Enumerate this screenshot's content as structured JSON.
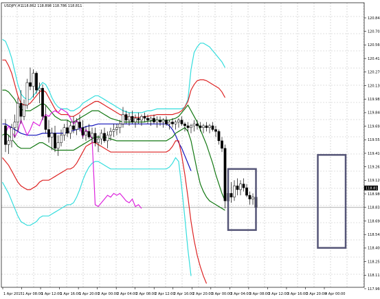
{
  "header": {
    "symbol": "USDJPY,H1",
    "ohlc": "118.862 118.898 118.786 118.811"
  },
  "price_tag": "118.811",
  "colors": {
    "background": "#ffffff",
    "grid": "#c0c0c0",
    "axis": "#000000",
    "candle_up_body": "#ffffff",
    "candle_down_body": "#000000",
    "bb_outer": "#33dddd",
    "bb_mid": "#dd2222",
    "bb_inner": "#117711",
    "ma": "#1111bb",
    "chikou": "#dd22dd",
    "box": "#555577"
  },
  "chart_data": {
    "type": "line",
    "y_ticks": [
      "120.845",
      "120.705",
      "120.560",
      "120.415",
      "120.270",
      "120.130",
      "119.985",
      "119.840",
      "119.695",
      "119.555",
      "119.410",
      "119.265",
      "119.120",
      "118.980",
      "118.835",
      "118.690",
      "118.545",
      "118.400",
      "118.255",
      "118.115",
      "117.960"
    ],
    "x_ticks": [
      "1 Apr 2015",
      "1 Apr 08:00",
      "1 Apr 12:00",
      "1 Apr 16:00",
      "1 Apr 20:00",
      "2 Apr 00:00",
      "2 Apr 04:00",
      "2 Apr 08:00",
      "2 Apr 12:00",
      "2 Apr 16:00",
      "2 Apr 20:00",
      "3 Apr 00:00",
      "3 Apr 04:00",
      "3 Apr 08:00",
      "3 Apr 12:00",
      "3 Apr 16:00",
      "3 Apr 20:00",
      "4 Apr 00:00"
    ],
    "ylim": [
      117.96,
      120.99
    ],
    "x_range": [
      0,
      108
    ],
    "candles": [
      [
        119.68,
        119.75,
        119.4,
        119.48
      ],
      [
        119.48,
        119.58,
        119.38,
        119.52
      ],
      [
        119.52,
        119.7,
        119.45,
        119.66
      ],
      [
        119.66,
        119.8,
        119.55,
        119.72
      ],
      [
        119.72,
        119.98,
        119.62,
        119.92
      ],
      [
        119.92,
        120.06,
        119.7,
        119.78
      ],
      [
        119.78,
        119.96,
        119.74,
        119.9
      ],
      [
        119.9,
        120.18,
        119.86,
        120.14
      ],
      [
        120.14,
        120.3,
        120.06,
        120.1
      ],
      [
        120.1,
        120.28,
        119.98,
        120.24
      ],
      [
        120.24,
        120.26,
        120.02,
        120.06
      ],
      [
        120.06,
        120.14,
        119.92,
        120.08
      ],
      [
        120.08,
        120.12,
        119.74,
        119.78
      ],
      [
        119.78,
        119.9,
        119.6,
        119.64
      ],
      [
        119.64,
        119.74,
        119.5,
        119.56
      ],
      [
        119.56,
        119.66,
        119.42,
        119.6
      ],
      [
        119.6,
        119.68,
        119.4,
        119.44
      ],
      [
        119.44,
        119.58,
        119.36,
        119.5
      ],
      [
        119.5,
        119.64,
        119.46,
        119.58
      ],
      [
        119.58,
        119.7,
        119.52,
        119.66
      ],
      [
        119.66,
        119.74,
        119.56,
        119.6
      ],
      [
        119.6,
        119.72,
        119.54,
        119.68
      ],
      [
        119.68,
        119.78,
        119.6,
        119.64
      ],
      [
        119.64,
        119.76,
        119.58,
        119.72
      ],
      [
        119.72,
        119.8,
        119.62,
        119.66
      ],
      [
        119.66,
        119.74,
        119.54,
        119.58
      ],
      [
        119.58,
        119.68,
        119.52,
        119.62
      ],
      [
        119.62,
        119.7,
        119.54,
        119.56
      ],
      [
        119.56,
        119.66,
        119.5,
        119.6
      ],
      [
        119.6,
        119.66,
        119.46,
        119.5
      ],
      [
        119.5,
        119.58,
        119.4,
        119.54
      ],
      [
        119.54,
        119.64,
        119.48,
        119.6
      ],
      [
        119.6,
        119.66,
        119.5,
        119.52
      ],
      [
        119.52,
        119.62,
        119.44,
        119.58
      ],
      [
        119.58,
        119.66,
        119.52,
        119.62
      ],
      [
        119.62,
        119.7,
        119.56,
        119.64
      ],
      [
        119.64,
        119.7,
        119.58,
        119.66
      ],
      [
        119.66,
        119.74,
        119.6,
        119.7
      ],
      [
        119.7,
        119.88,
        119.66,
        119.8
      ],
      [
        119.8,
        119.84,
        119.7,
        119.74
      ],
      [
        119.74,
        119.82,
        119.68,
        119.78
      ],
      [
        119.78,
        119.84,
        119.7,
        119.72
      ],
      [
        119.72,
        119.8,
        119.66,
        119.76
      ],
      [
        119.76,
        119.82,
        119.7,
        119.74
      ],
      [
        119.74,
        119.8,
        119.68,
        119.78
      ],
      [
        119.78,
        119.82,
        119.72,
        119.76
      ],
      [
        119.76,
        119.8,
        119.7,
        119.74
      ],
      [
        119.74,
        119.78,
        119.68,
        119.76
      ],
      [
        119.76,
        119.8,
        119.7,
        119.72
      ],
      [
        119.72,
        119.78,
        119.66,
        119.74
      ],
      [
        119.74,
        119.78,
        119.68,
        119.72
      ],
      [
        119.72,
        119.76,
        119.66,
        119.74
      ],
      [
        119.74,
        119.78,
        119.68,
        119.7
      ],
      [
        119.7,
        119.74,
        119.64,
        119.72
      ],
      [
        119.72,
        119.76,
        119.66,
        119.7
      ],
      [
        119.7,
        119.74,
        119.64,
        119.72
      ],
      [
        119.72,
        119.76,
        119.66,
        119.74
      ],
      [
        119.74,
        119.78,
        119.68,
        119.7
      ],
      [
        119.7,
        119.72,
        119.62,
        119.68
      ],
      [
        119.68,
        119.72,
        119.62,
        119.66
      ],
      [
        119.66,
        119.7,
        119.6,
        119.68
      ],
      [
        119.68,
        119.74,
        119.62,
        119.7
      ],
      [
        119.7,
        119.74,
        119.64,
        119.68
      ],
      [
        119.68,
        119.72,
        119.62,
        119.66
      ],
      [
        119.66,
        119.7,
        119.6,
        119.68
      ],
      [
        119.68,
        119.72,
        119.62,
        119.66
      ],
      [
        119.66,
        119.7,
        119.6,
        119.68
      ],
      [
        119.68,
        119.72,
        119.62,
        119.64
      ],
      [
        119.64,
        119.68,
        119.56,
        119.62
      ],
      [
        119.62,
        119.64,
        119.48,
        119.52
      ],
      [
        119.52,
        119.56,
        119.4,
        119.44
      ],
      [
        119.44,
        119.48,
        118.8,
        118.88
      ],
      [
        118.88,
        119.1,
        118.72,
        118.96
      ],
      [
        118.96,
        119.08,
        118.86,
        118.92
      ],
      [
        118.92,
        119.1,
        118.88,
        119.04
      ],
      [
        119.04,
        119.12,
        118.94,
        119.0
      ],
      [
        119.0,
        119.1,
        118.94,
        119.06
      ],
      [
        119.06,
        119.12,
        118.98,
        119.02
      ],
      [
        119.02,
        119.06,
        118.92,
        118.94
      ],
      [
        118.94,
        118.98,
        118.84,
        118.9
      ],
      [
        118.9,
        118.96,
        118.84,
        118.92
      ],
      [
        118.92,
        118.94,
        118.78,
        118.81
      ]
    ],
    "series": [
      {
        "values": [
          120.36,
          120.3,
          120.38,
          120.5,
          120.56,
          120.58,
          120.54,
          120.56,
          120.6,
          120.58,
          120.5,
          120.4,
          120.26,
          120.12,
          120.02,
          119.98,
          119.96,
          119.96,
          120.0,
          120.04,
          120.1,
          120.14,
          120.12,
          120.06,
          119.98,
          119.92,
          119.88,
          119.86,
          119.86,
          119.86,
          119.84,
          119.84,
          119.86,
          119.88,
          119.92,
          119.94,
          119.96,
          119.98,
          120.0,
          120.0,
          119.98,
          119.96,
          119.94,
          119.92,
          119.9,
          119.88,
          119.86,
          119.84,
          119.83,
          119.82,
          119.82,
          119.82,
          119.82,
          119.82,
          119.83,
          119.84,
          119.84,
          119.85,
          119.86,
          119.86,
          119.86,
          119.86,
          119.86,
          119.86,
          119.86,
          119.86,
          119.86,
          119.88,
          119.96,
          120.28,
          120.46,
          120.52,
          120.56,
          120.56,
          120.54,
          120.52,
          120.48,
          120.44,
          120.4,
          120.36,
          120.3
        ]
      },
      {
        "values": [
          120.14,
          120.08,
          120.1,
          120.18,
          120.22,
          120.26,
          120.3,
          120.34,
          120.38,
          120.38,
          120.32,
          120.24,
          120.12,
          120.0,
          119.92,
          119.9,
          119.9,
          119.92,
          119.96,
          120.0,
          120.04,
          120.06,
          120.04,
          119.98,
          119.92,
          119.86,
          119.82,
          119.8,
          119.8,
          119.8,
          119.78,
          119.78,
          119.8,
          119.82,
          119.86,
          119.88,
          119.9,
          119.92,
          119.94,
          119.94,
          119.92,
          119.9,
          119.88,
          119.86,
          119.84,
          119.82,
          119.8,
          119.79,
          119.78,
          119.77,
          119.77,
          119.77,
          119.77,
          119.77,
          119.78,
          119.78,
          119.79,
          119.79,
          119.8,
          119.8,
          119.8,
          119.8,
          119.8,
          119.8,
          119.81,
          119.82,
          119.84,
          119.88,
          119.94,
          120.06,
          120.12,
          120.16,
          120.17,
          120.17,
          120.16,
          120.14,
          120.12,
          120.1,
          120.08,
          120.04,
          119.98
        ]
      },
      {
        "values": [
          119.96,
          119.92,
          119.94,
          119.98,
          120.02,
          120.04,
          120.06,
          120.06,
          120.06,
          120.06,
          120.04,
          120.0,
          119.96,
          119.9,
          119.86,
          119.84,
          119.84,
          119.84,
          119.86,
          119.88,
          119.9,
          119.92,
          119.9,
          119.86,
          119.82,
          119.78,
          119.76,
          119.74,
          119.74,
          119.74,
          119.72,
          119.72,
          119.74,
          119.76,
          119.78,
          119.8,
          119.82,
          119.84,
          119.84,
          119.84,
          119.82,
          119.8,
          119.78,
          119.76,
          119.75,
          119.74,
          119.73,
          119.72,
          119.72,
          119.72,
          119.72,
          119.72,
          119.72,
          119.72,
          119.72,
          119.73,
          119.73,
          119.74,
          119.74,
          119.74,
          119.74,
          119.74,
          119.74,
          119.75,
          119.76,
          119.78,
          119.82,
          119.86,
          119.9,
          119.84,
          119.78,
          119.72,
          119.64,
          119.56,
          119.48,
          119.38,
          119.28,
          119.16,
          119.06,
          118.96,
          118.88
        ]
      },
      {
        "values": [
          119.84,
          119.8,
          119.78,
          119.76,
          119.74,
          119.72,
          119.72,
          119.7,
          119.7,
          119.7,
          119.68,
          119.66,
          119.64,
          119.62,
          119.6,
          119.59,
          119.58,
          119.58,
          119.58,
          119.58,
          119.59,
          119.6,
          119.6,
          119.6,
          119.6,
          119.6,
          119.6,
          119.6,
          119.6,
          119.61,
          119.62,
          119.63,
          119.64,
          119.65,
          119.66,
          119.67,
          119.68,
          119.68,
          119.69,
          119.7,
          119.7,
          119.7,
          119.7,
          119.7,
          119.7,
          119.7,
          119.7,
          119.7,
          119.7,
          119.7,
          119.7,
          119.7,
          119.7,
          119.7,
          119.7,
          119.7,
          119.7,
          119.7,
          119.7,
          119.7,
          119.7,
          119.7,
          119.68,
          119.64,
          119.58,
          119.5,
          119.44,
          119.36,
          119.28,
          119.2
        ]
      },
      {
        "values": [
          119.52,
          119.48,
          119.5,
          119.54,
          119.56,
          119.58,
          119.56,
          119.56,
          119.58,
          119.6,
          119.58,
          119.54,
          119.5,
          119.46,
          119.44,
          119.44,
          119.44,
          119.44,
          119.46,
          119.48,
          119.5,
          119.5,
          119.48,
          119.46,
          119.44,
          119.42,
          119.42,
          119.42,
          119.42,
          119.42,
          119.42,
          119.42,
          119.44,
          119.46,
          119.48,
          119.5,
          119.52,
          119.54,
          119.56,
          119.56,
          119.56,
          119.56,
          119.55,
          119.54,
          119.53,
          119.52,
          119.52,
          119.52,
          119.52,
          119.52,
          119.52,
          119.52,
          119.52,
          119.52,
          119.52,
          119.52,
          119.52,
          119.52,
          119.52,
          119.52,
          119.52,
          119.52,
          119.54,
          119.56,
          119.6,
          119.62,
          119.64,
          119.66,
          119.62,
          119.52,
          119.36,
          119.2,
          119.06,
          118.98,
          118.92,
          118.88,
          118.86,
          118.84,
          118.82,
          118.8,
          118.78
        ]
      },
      {
        "values": [
          119.3,
          119.28,
          119.3,
          119.34,
          119.36,
          119.38,
          119.38,
          119.36,
          119.34,
          119.3,
          119.26,
          119.2,
          119.14,
          119.08,
          119.04,
          119.02,
          119.0,
          119.0,
          119.02,
          119.04,
          119.08,
          119.1,
          119.1,
          119.1,
          119.12,
          119.14,
          119.16,
          119.18,
          119.2,
          119.22,
          119.22,
          119.24,
          119.28,
          119.34,
          119.4,
          119.46,
          119.48,
          119.5,
          119.5,
          119.48,
          119.46,
          119.44,
          119.42,
          119.4,
          119.4,
          119.4,
          119.4,
          119.4,
          119.4,
          119.4,
          119.4,
          119.4,
          119.4,
          119.4,
          119.4,
          119.4,
          119.4,
          119.4,
          119.4,
          119.4,
          119.4,
          119.4,
          119.42,
          119.46,
          119.52,
          119.52,
          119.36,
          119.16,
          118.92,
          118.66,
          118.46,
          118.3,
          118.18,
          118.08,
          118.0,
          117.94,
          117.88,
          117.84,
          117.8,
          117.78,
          117.76
        ]
      },
      {
        "values": [
          119.06,
          119.04,
          119.06,
          119.1,
          119.12,
          119.14,
          119.14,
          119.12,
          119.08,
          119.02,
          118.96,
          118.88,
          118.8,
          118.72,
          118.66,
          118.64,
          118.62,
          118.62,
          118.64,
          118.66,
          118.7,
          118.72,
          118.72,
          118.72,
          118.74,
          118.76,
          118.78,
          118.8,
          118.82,
          118.84,
          118.84,
          118.86,
          118.92,
          119.0,
          119.1,
          119.18,
          119.24,
          119.28,
          119.3,
          119.3,
          119.28,
          119.26,
          119.24,
          119.22,
          119.22,
          119.22,
          119.22,
          119.22,
          119.22,
          119.22,
          119.22,
          119.22,
          119.22,
          119.22,
          119.22,
          119.22,
          119.22,
          119.22,
          119.22,
          119.22,
          119.22,
          119.22,
          119.24,
          119.28,
          119.34,
          119.3,
          119.02,
          118.7,
          118.36,
          118.08,
          117.86,
          117.7,
          117.56,
          117.44,
          117.34,
          117.26,
          117.2,
          117.14,
          117.1,
          117.06,
          117.02
        ]
      },
      {
        "values": [
          119.6,
          119.68,
          119.62,
          119.56,
          119.62,
          119.74,
          119.66,
          119.58,
          119.64,
          119.72,
          119.7,
          119.68,
          119.76,
          119.8,
          119.78,
          119.82,
          119.84,
          119.82,
          119.86,
          119.84,
          119.82,
          119.76,
          119.7,
          119.74,
          119.68,
          119.56,
          119.64,
          119.6,
          119.54,
          118.84,
          118.82,
          118.86,
          118.9,
          118.94,
          118.92,
          118.96,
          118.94,
          118.96,
          118.92,
          118.88,
          118.86,
          118.9,
          118.82,
          118.84,
          118.8
        ]
      }
    ],
    "series_x0": [
      -9,
      -9,
      -9,
      -9,
      -9,
      -9,
      -9,
      0
    ],
    "boxes": [
      {
        "x0": 72,
        "x1": 81,
        "y0": 119.22,
        "y1": 118.57
      },
      {
        "x0": 101,
        "x1": 110,
        "y0": 119.37,
        "y1": 118.38
      }
    ]
  }
}
